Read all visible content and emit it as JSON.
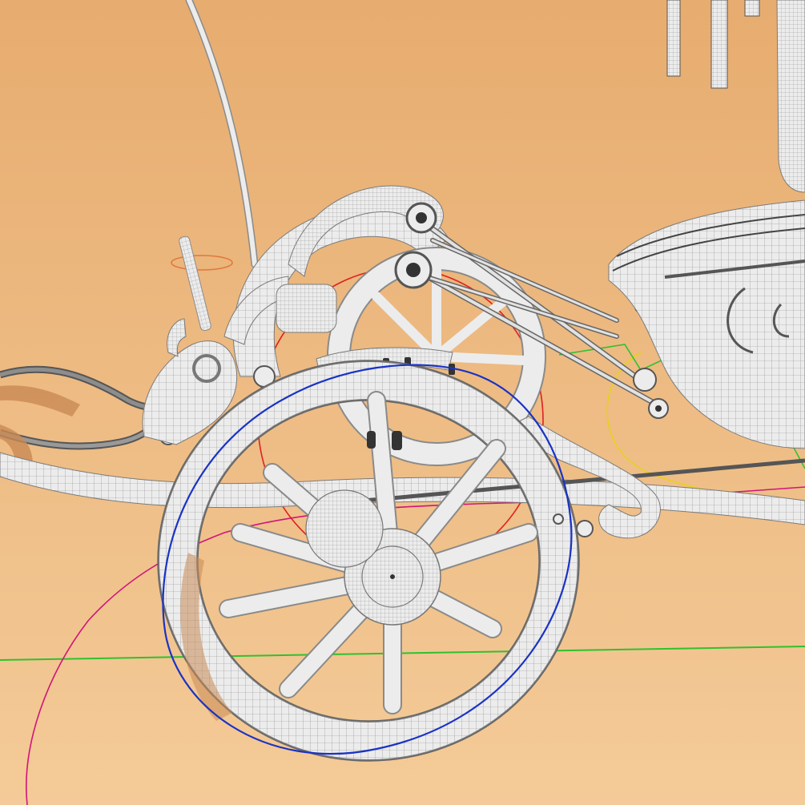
{
  "scene": {
    "background_top": "#e7ac6f",
    "background_bottom": "#f4cb98",
    "model_fill": "#ececec",
    "model_wire": "#8a8a8a",
    "model_dark": "#3a3a3a",
    "shadow_tint": "#c98a55",
    "guides": {
      "ground_axis": "#2fc12f",
      "wheel_circle": "#1a33c4",
      "rear_circle": "#e02020",
      "path_curve": "#d0157a",
      "light_ring": "#e6d21a",
      "light_gizmo": "#e0783c"
    }
  }
}
